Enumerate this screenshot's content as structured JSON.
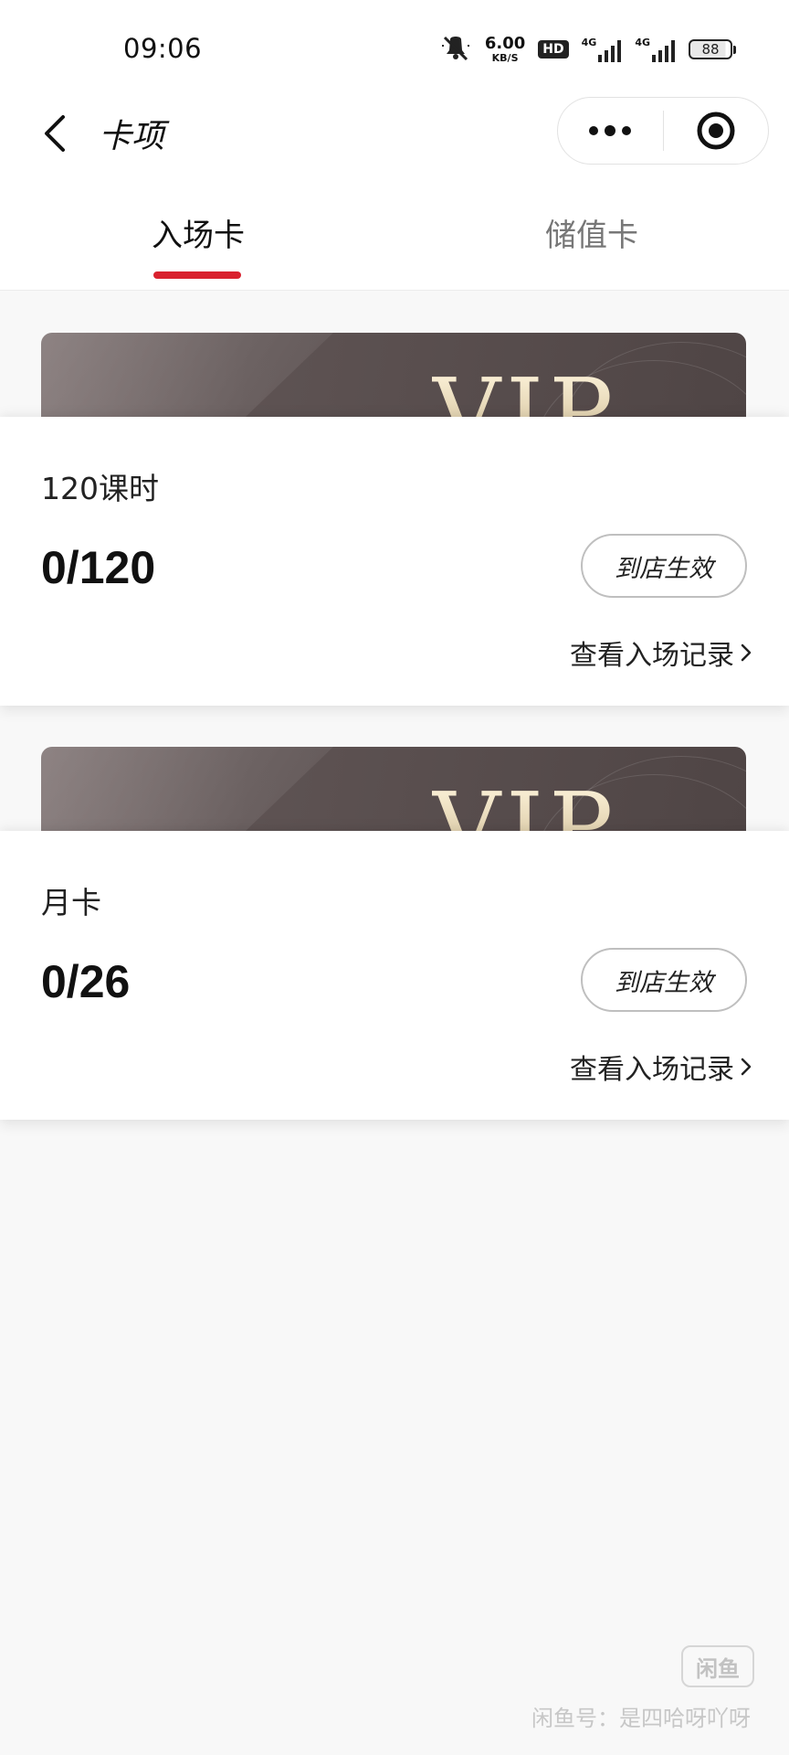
{
  "status_bar": {
    "time": "09:06",
    "net_speed_value": "6.00",
    "net_speed_unit": "KB/S",
    "hd_label": "HD",
    "signal_1_label": "4G",
    "signal_2_label": "4G",
    "battery": "88"
  },
  "nav": {
    "title": "卡项"
  },
  "tabs": [
    {
      "label": "入场卡",
      "active": true
    },
    {
      "label": "储值卡",
      "active": false
    }
  ],
  "cards": [
    {
      "banner_text": "VIP",
      "name": "120课时",
      "count": "0/120",
      "button_label": "到店生效",
      "record_link": "查看入场记录"
    },
    {
      "banner_text": "VIP",
      "name": "月卡",
      "count": "0/26",
      "button_label": "到店生效",
      "record_link": "查看入场记录"
    }
  ],
  "watermark": {
    "logo_text": "闲鱼",
    "text": "闲鱼号：是四哈呀吖呀"
  },
  "colors": {
    "accent": "#d9222f",
    "page_bg": "#f8f8f8",
    "banner_dark": "#4f4545"
  }
}
